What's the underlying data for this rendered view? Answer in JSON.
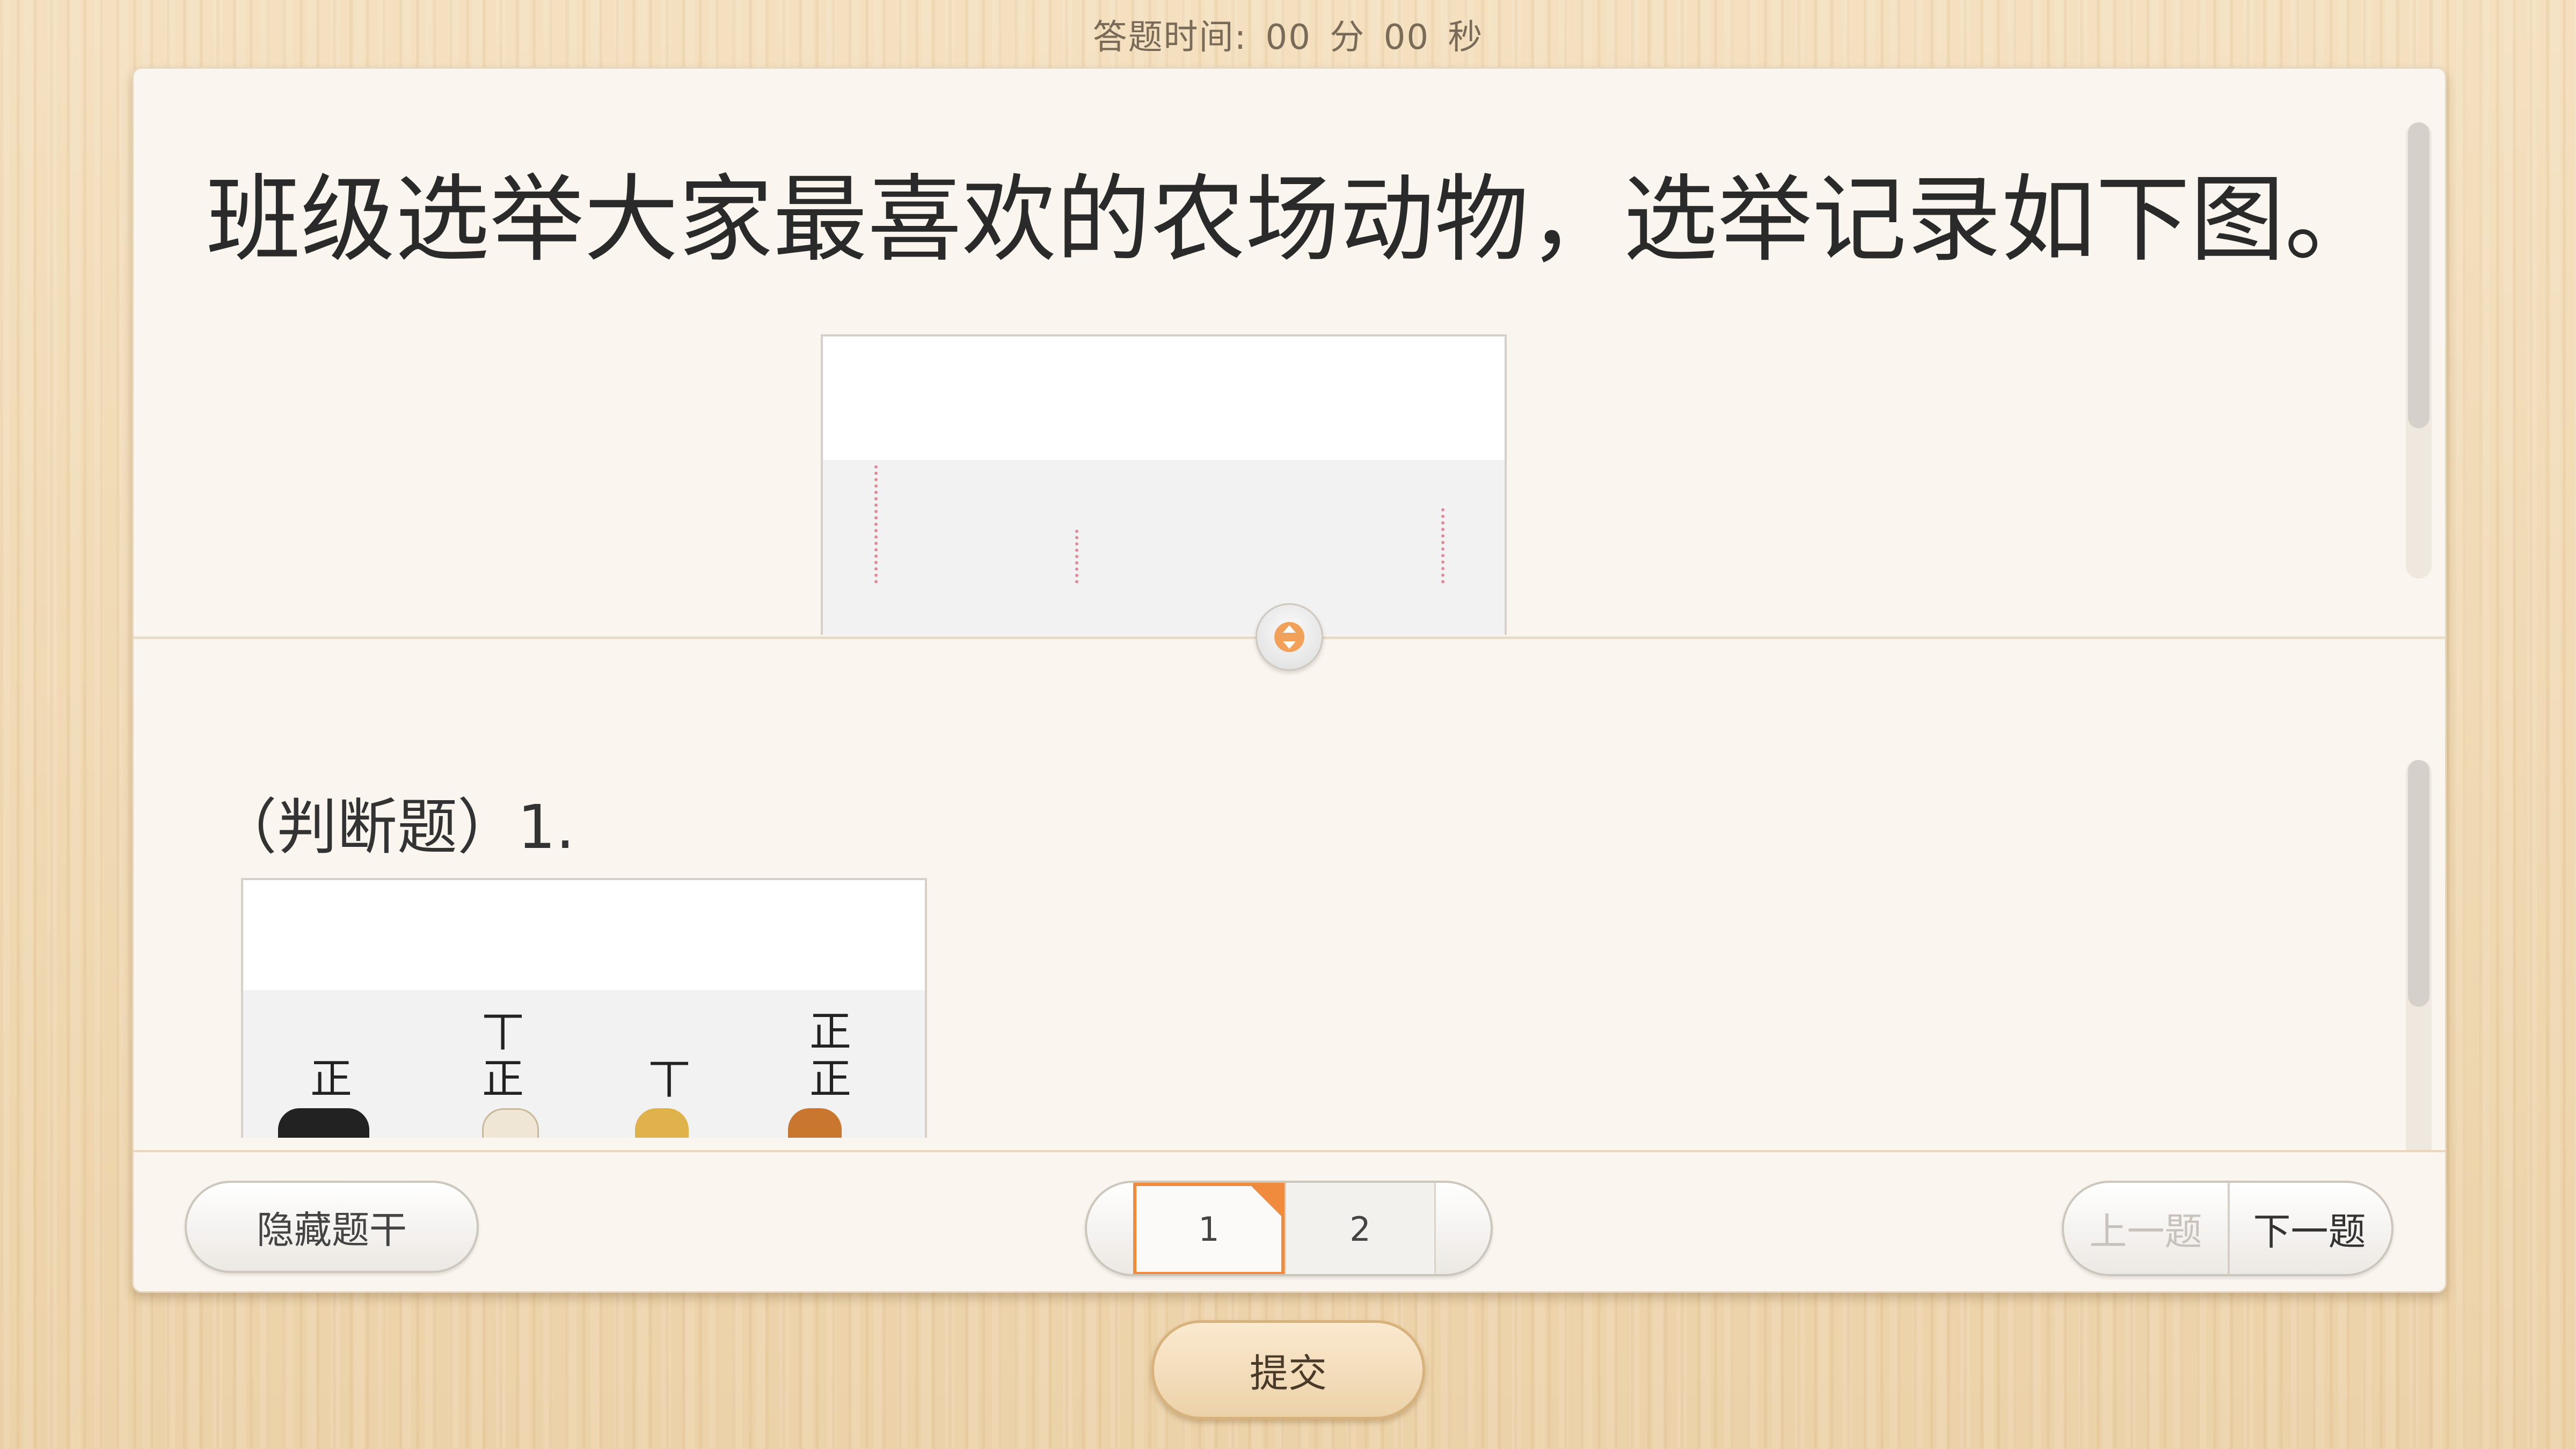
{
  "timer": {
    "label": "答题时间:",
    "minutes": "00",
    "minutes_unit": "分",
    "seconds": "00",
    "seconds_unit": "秒"
  },
  "stem": {
    "title": "班级选举大家最喜欢的农场动物，选举记录如下图。"
  },
  "sub_question": {
    "title": "（判断题）1.",
    "tally_marks": [
      "正",
      "丅",
      "正",
      "丅",
      "正",
      "正"
    ]
  },
  "footer": {
    "hide_stem_label": "隐藏题干",
    "pages": [
      "1",
      "2"
    ],
    "current_page": "1",
    "prev_label": "上一题",
    "next_label": "下一题"
  },
  "submit_label": "提交",
  "colors": {
    "accent": "#f08a3c",
    "card_bg": "#faf5ee",
    "wood_bg": "#f0d9b4"
  },
  "icons": {
    "handle": "drag-handle-icon",
    "flag": "bookmark-flag-icon"
  }
}
